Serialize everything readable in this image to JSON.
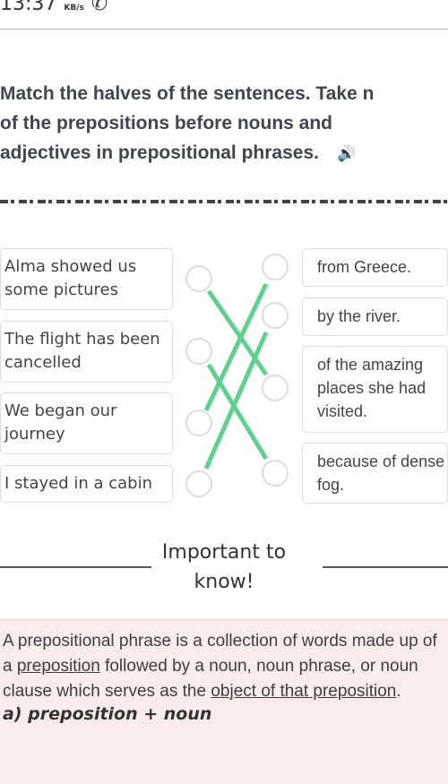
{
  "status": {
    "time": "13:37",
    "speed": "KB/s"
  },
  "instruction": "Match the halves of the sentences. Take note of the prepositions before nouns and adjectives in prepositional phrases.",
  "instruction_lines": [
    "Match the halves of the sentences. Take n",
    "of the prepositions before nouns and",
    "adjectives in prepositional phrases."
  ],
  "left_items": [
    "Alma showed us some pictures",
    "The flight has been cancelled",
    "We began our journey",
    "I stayed in a cabin"
  ],
  "right_items": [
    "from Greece.",
    "by the river.",
    "of the amazing places she had visited.",
    "because of dense fog."
  ],
  "matches": [
    [
      1,
      3
    ],
    [
      2,
      4
    ],
    [
      3,
      1
    ],
    [
      4,
      2
    ]
  ],
  "line_color": "#5fd08f",
  "important": {
    "title": "Important to know!"
  },
  "info": {
    "p1": "A prepositional phrase is a collection of words made up of a ",
    "link1": "preposition",
    "p2": " followed by a noun, noun phrase, or noun clause which serves as the ",
    "link2": "object of that preposition",
    "p3": ".",
    "subheading": "a) preposition + noun"
  }
}
